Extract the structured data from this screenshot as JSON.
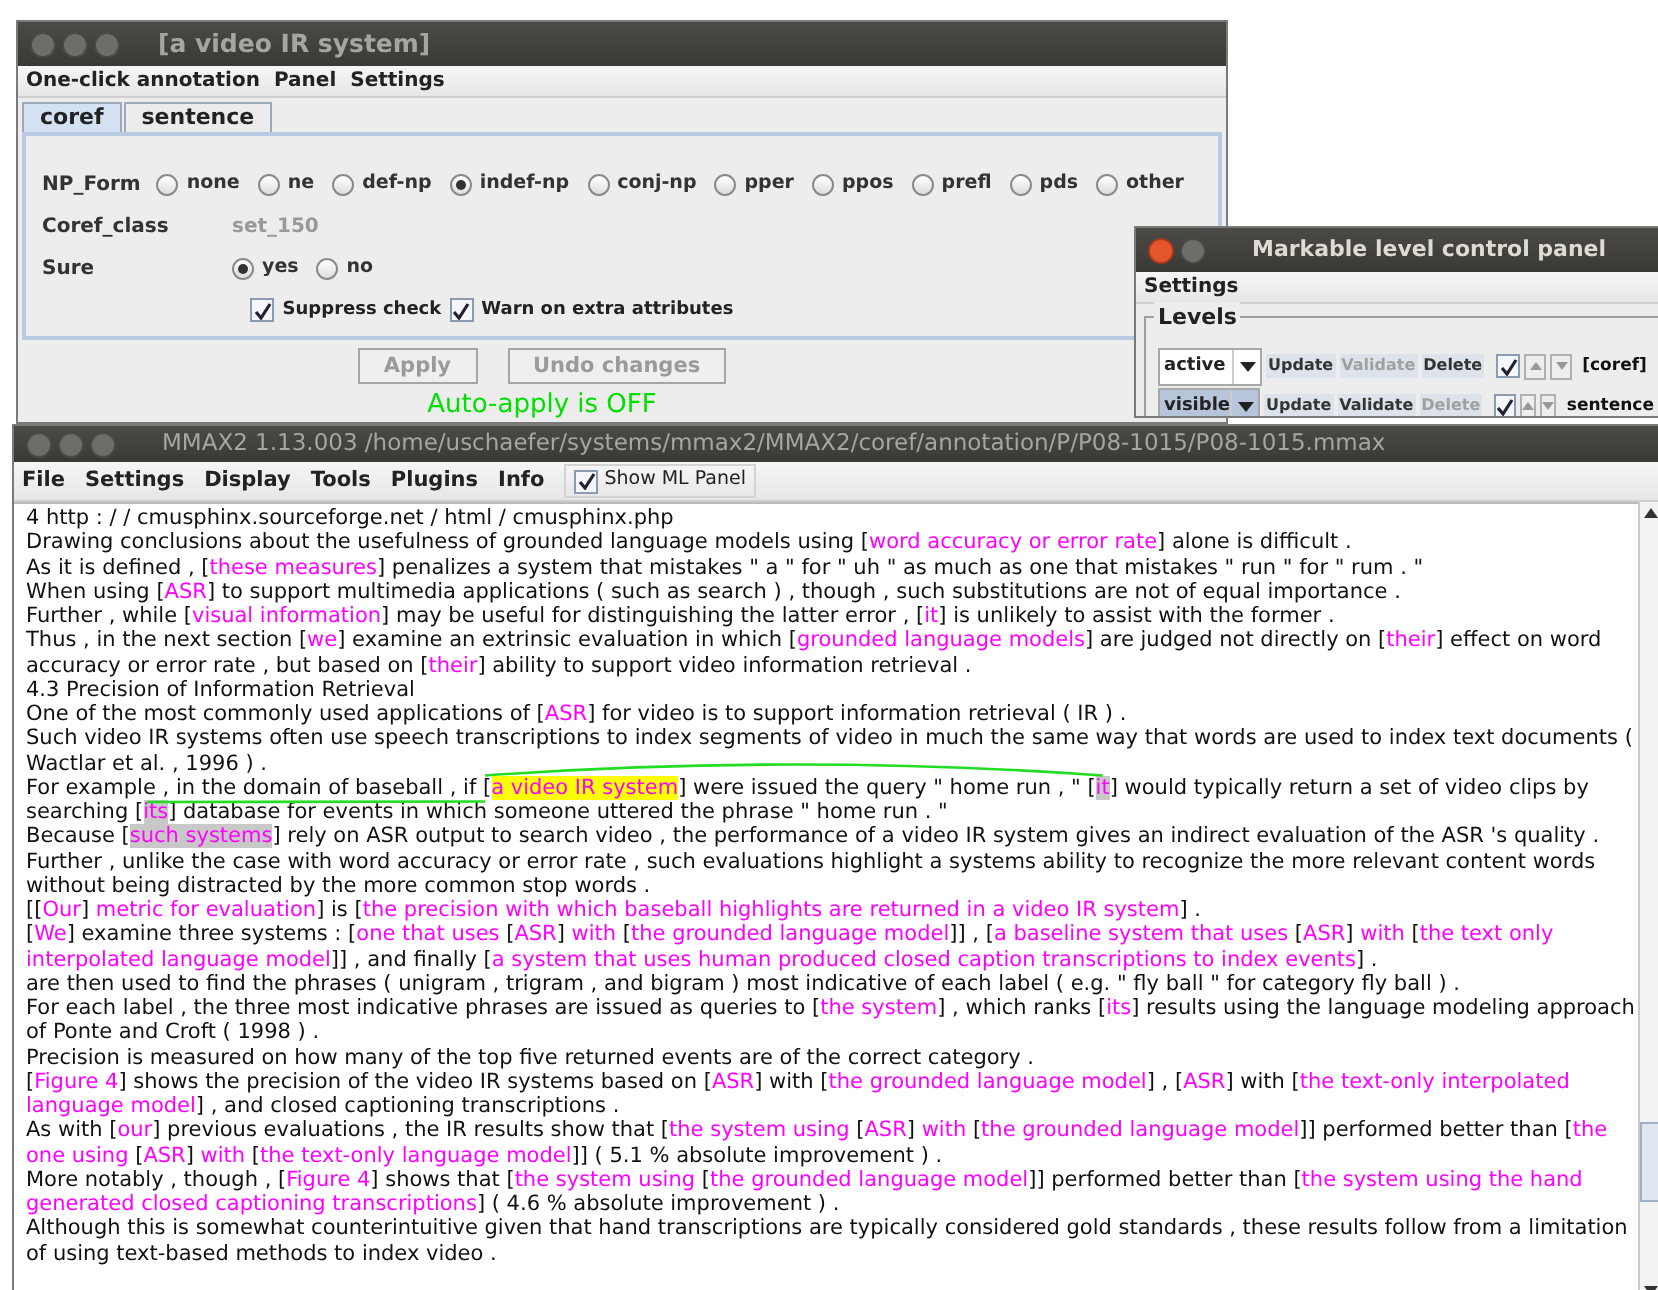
{
  "attribute_window": {
    "title": "[a video IR system]",
    "menu": [
      "One-click annotation",
      "Panel",
      "Settings"
    ],
    "tabs": [
      {
        "label": "coref",
        "selected": true
      },
      {
        "label": "sentence",
        "selected": false
      }
    ],
    "attributes": [
      {
        "label": "NP_Form",
        "kind": "radio",
        "options": [
          {
            "label": "none",
            "selected": false
          },
          {
            "label": "ne",
            "selected": false
          },
          {
            "label": "def-np",
            "selected": false
          },
          {
            "label": "indef-np",
            "selected": true
          },
          {
            "label": "conj-np",
            "selected": false
          },
          {
            "label": "pper",
            "selected": false
          },
          {
            "label": "ppos",
            "selected": false
          },
          {
            "label": "prefl",
            "selected": false
          },
          {
            "label": "pds",
            "selected": false
          },
          {
            "label": "other",
            "selected": false
          }
        ]
      },
      {
        "label": "Coref_class",
        "kind": "text",
        "value": "set_150"
      },
      {
        "label": "Sure",
        "kind": "radio",
        "options": [
          {
            "label": "yes",
            "selected": true
          },
          {
            "label": "no",
            "selected": false
          }
        ]
      }
    ],
    "checkboxes": [
      {
        "label": "Suppress check",
        "checked": true
      },
      {
        "label": "Warn on extra attributes",
        "checked": true
      }
    ],
    "buttons": [
      {
        "label": "Apply",
        "disabled": true
      },
      {
        "label": "Undo changes",
        "disabled": true
      }
    ],
    "status": "Auto-apply is OFF"
  },
  "level_panel": {
    "title": "Markable level control panel",
    "menu": [
      "Settings"
    ],
    "group": "Levels",
    "levels": [
      {
        "mode": "active",
        "selected": false,
        "actions": [
          {
            "label": "Update",
            "disabled": false
          },
          {
            "label": "Validate",
            "disabled": true
          },
          {
            "label": "Delete",
            "disabled": false
          }
        ],
        "checked": true,
        "name": "[coref]"
      },
      {
        "mode": "visible",
        "selected": true,
        "actions": [
          {
            "label": "Update",
            "disabled": false
          },
          {
            "label": "Validate",
            "disabled": false
          },
          {
            "label": "Delete",
            "disabled": true
          }
        ],
        "checked": true,
        "name": "sentence"
      }
    ]
  },
  "main_window": {
    "title": "MMAX2 1.13.003 /home/uschaefer/systems/mmax2/MMAX2/coref/annotation/P/P08-1015/P08-1015.mmax",
    "menu": [
      "File",
      "Settings",
      "Display",
      "Tools",
      "Plugins",
      "Info"
    ],
    "menu_checkbox": {
      "label": "Show ML Panel",
      "checked": true
    },
    "document": [
      [
        {
          "kind": "plain",
          "text": "4 http : / / cmusphinx.sourceforge.net / html / cmusphinx.php"
        }
      ],
      [
        {
          "kind": "plain",
          "text": "Drawing conclusions about the usefulness of grounded language models using ["
        },
        {
          "kind": "markable",
          "text": "word accuracy or error rate"
        },
        {
          "kind": "plain",
          "text": "] alone is difficult ."
        }
      ],
      [
        {
          "kind": "plain",
          "text": "As it is defined , ["
        },
        {
          "kind": "markable",
          "text": "these measures"
        },
        {
          "kind": "plain",
          "text": "] penalizes a system that mistakes \" a \" for \" uh \" as much as one that mistakes \" run \" for \" rum . \""
        }
      ],
      [
        {
          "kind": "plain",
          "text": "When using ["
        },
        {
          "kind": "markable",
          "text": "ASR"
        },
        {
          "kind": "plain",
          "text": "] to support multimedia applications ( such as search ) , though , such substitutions are not of equal importance ."
        }
      ],
      [
        {
          "kind": "plain",
          "text": "Further , while ["
        },
        {
          "kind": "markable",
          "text": "visual information"
        },
        {
          "kind": "plain",
          "text": "] may be useful for distinguishing the latter error , ["
        },
        {
          "kind": "markable",
          "text": "it"
        },
        {
          "kind": "plain",
          "text": "] is unlikely to assist with the former ."
        }
      ],
      [
        {
          "kind": "plain",
          "text": "Thus , in the next section ["
        },
        {
          "kind": "markable",
          "text": "we"
        },
        {
          "kind": "plain",
          "text": "] examine an extrinsic evaluation in which ["
        },
        {
          "kind": "markable",
          "text": "grounded language models"
        },
        {
          "kind": "plain",
          "text": "] are judged not directly on ["
        },
        {
          "kind": "markable",
          "text": "their"
        },
        {
          "kind": "plain",
          "text": "] effect on word accuracy or error rate , but based on ["
        },
        {
          "kind": "markable",
          "text": "their"
        },
        {
          "kind": "plain",
          "text": "] ability to support video information retrieval ."
        }
      ],
      [
        {
          "kind": "plain",
          "text": "4.3 Precision of Information Retrieval"
        }
      ],
      [
        {
          "kind": "plain",
          "text": "One of the most commonly used applications of ["
        },
        {
          "kind": "markable",
          "text": "ASR"
        },
        {
          "kind": "plain",
          "text": "] for video is to support information retrieval ( IR ) ."
        }
      ],
      [
        {
          "kind": "plain",
          "text": "Such video IR systems often use speech transcriptions to index segments of video in much the same way that words are used to index text documents ( Wactlar et al. , 1996 ) ."
        }
      ],
      [
        {
          "kind": "plain",
          "text": "For example , in the domain of baseball , if ["
        },
        {
          "kind": "selected",
          "text": "a video IR system"
        },
        {
          "kind": "plain",
          "text": "] were issued the query \" home run , \" ["
        },
        {
          "kind": "linked",
          "text": "it"
        },
        {
          "kind": "plain",
          "text": "] would typically return a set of video clips by searching ["
        },
        {
          "kind": "linked",
          "text": "its"
        },
        {
          "kind": "plain",
          "text": "] database for events in which someone uttered the phrase \" home run . \""
        }
      ],
      [
        {
          "kind": "plain",
          "text": "Because ["
        },
        {
          "kind": "linked",
          "text": "such systems"
        },
        {
          "kind": "plain",
          "text": "] rely on ASR output to search video , the performance of a video IR system gives an indirect evaluation of the ASR 's quality ."
        }
      ],
      [
        {
          "kind": "plain",
          "text": "Further , unlike the case with word accuracy or error rate , such evaluations highlight a systems ability to recognize the more relevant content words without being distracted by the more common stop words ."
        }
      ],
      [
        {
          "kind": "plain",
          "text": "[["
        },
        {
          "kind": "markable",
          "text": "Our"
        },
        {
          "kind": "plain",
          "text": "]"
        },
        {
          "kind": "markable",
          "text": " metric for evaluation"
        },
        {
          "kind": "plain",
          "text": "] is ["
        },
        {
          "kind": "markable",
          "text": "the precision with which baseball highlights are returned in a video IR system"
        },
        {
          "kind": "plain",
          "text": "] ."
        }
      ],
      [
        {
          "kind": "plain",
          "text": "["
        },
        {
          "kind": "markable",
          "text": "We"
        },
        {
          "kind": "plain",
          "text": "] examine three systems : ["
        },
        {
          "kind": "markable",
          "text": "one that uses "
        },
        {
          "kind": "plain",
          "text": "["
        },
        {
          "kind": "markable",
          "text": "ASR"
        },
        {
          "kind": "plain",
          "text": "]"
        },
        {
          "kind": "markable",
          "text": " with "
        },
        {
          "kind": "plain",
          "text": "["
        },
        {
          "kind": "markable",
          "text": "the grounded language model"
        },
        {
          "kind": "plain",
          "text": "]] , ["
        },
        {
          "kind": "markable",
          "text": "a baseline system that uses "
        },
        {
          "kind": "plain",
          "text": "["
        },
        {
          "kind": "markable",
          "text": "ASR"
        },
        {
          "kind": "plain",
          "text": "]"
        },
        {
          "kind": "markable",
          "text": " with "
        },
        {
          "kind": "plain",
          "text": "["
        },
        {
          "kind": "markable",
          "text": "the text only interpolated language model"
        },
        {
          "kind": "plain",
          "text": "]] , and finally ["
        },
        {
          "kind": "markable",
          "text": "a system that uses human produced closed caption transcriptions to index events"
        },
        {
          "kind": "plain",
          "text": "] ."
        }
      ],
      [
        {
          "kind": "plain",
          "text": "are then used to find the phrases ( unigram , trigram , and bigram ) most indicative of each label ( e.g. \" fly ball \" for category fly ball ) ."
        }
      ],
      [
        {
          "kind": "plain",
          "text": "For each label , the three most indicative phrases are issued as queries to ["
        },
        {
          "kind": "markable",
          "text": "the system"
        },
        {
          "kind": "plain",
          "text": "] , which ranks ["
        },
        {
          "kind": "markable",
          "text": "its"
        },
        {
          "kind": "plain",
          "text": "] results using the language modeling approach of Ponte and Croft ( 1998 ) ."
        }
      ],
      [
        {
          "kind": "plain",
          "text": "Precision is measured on how many of the top five returned events are of the correct category ."
        }
      ],
      [
        {
          "kind": "plain",
          "text": "["
        },
        {
          "kind": "markable",
          "text": "Figure 4"
        },
        {
          "kind": "plain",
          "text": "] shows the precision of the video IR systems based on ["
        },
        {
          "kind": "markable",
          "text": "ASR"
        },
        {
          "kind": "plain",
          "text": "] with ["
        },
        {
          "kind": "markable",
          "text": "the grounded language model"
        },
        {
          "kind": "plain",
          "text": "] , ["
        },
        {
          "kind": "markable",
          "text": "ASR"
        },
        {
          "kind": "plain",
          "text": "] with ["
        },
        {
          "kind": "markable",
          "text": "the text-only interpolated language model"
        },
        {
          "kind": "plain",
          "text": "] , and closed captioning transcriptions ."
        }
      ],
      [
        {
          "kind": "plain",
          "text": "As with ["
        },
        {
          "kind": "markable",
          "text": "our"
        },
        {
          "kind": "plain",
          "text": "] previous evaluations , the IR results show that ["
        },
        {
          "kind": "markable",
          "text": "the system using "
        },
        {
          "kind": "plain",
          "text": "["
        },
        {
          "kind": "markable",
          "text": "ASR"
        },
        {
          "kind": "plain",
          "text": "]"
        },
        {
          "kind": "markable",
          "text": " with "
        },
        {
          "kind": "plain",
          "text": "["
        },
        {
          "kind": "markable",
          "text": "the grounded language model"
        },
        {
          "kind": "plain",
          "text": "]] performed better than ["
        },
        {
          "kind": "markable",
          "text": "the one using "
        },
        {
          "kind": "plain",
          "text": "["
        },
        {
          "kind": "markable",
          "text": "ASR"
        },
        {
          "kind": "plain",
          "text": "]"
        },
        {
          "kind": "markable",
          "text": " with "
        },
        {
          "kind": "plain",
          "text": "["
        },
        {
          "kind": "markable",
          "text": "the text-only language model"
        },
        {
          "kind": "plain",
          "text": "]] ( 5.1 % absolute improvement ) ."
        }
      ],
      [
        {
          "kind": "plain",
          "text": "More notably , though , ["
        },
        {
          "kind": "markable",
          "text": "Figure 4"
        },
        {
          "kind": "plain",
          "text": "] shows that ["
        },
        {
          "kind": "markable",
          "text": "the system using "
        },
        {
          "kind": "plain",
          "text": "["
        },
        {
          "kind": "markable",
          "text": "the grounded language model"
        },
        {
          "kind": "plain",
          "text": "]] performed better than ["
        },
        {
          "kind": "markable",
          "text": "the system using the hand generated closed captioning transcriptions"
        },
        {
          "kind": "plain",
          "text": "] ( 4.6 % absolute improvement ) ."
        }
      ],
      [
        {
          "kind": "plain",
          "text": "Although this is somewhat counterintuitive given that hand transcriptions are typically considered gold standards , these results follow from a limitation of using text-based methods to index video ."
        }
      ]
    ]
  }
}
